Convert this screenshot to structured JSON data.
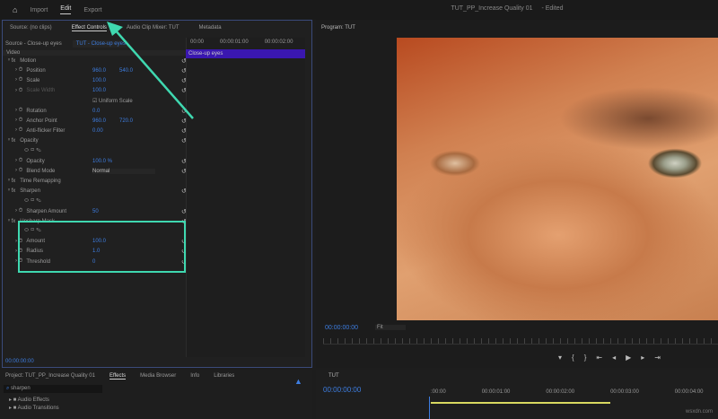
{
  "topbar": {
    "tabs": [
      "Import",
      "Edit",
      "Export"
    ],
    "active": "Edit",
    "title": "TUT_PP_Increase Quality 01",
    "status": "- Edited"
  },
  "left_panel": {
    "tabs": [
      "Source: (no clips)",
      "Effect Controls",
      "Audio Clip Mixer: TUT",
      "Metadata"
    ],
    "source_label": "Source - Close-up eyes",
    "sequence_label": "TUT - Close-up eyes",
    "timeline_ticks": [
      "00:00",
      "00:00:01:00",
      "00:00:02:00"
    ],
    "clip_name": "Close-up eyes",
    "section": "Video",
    "rows": [
      {
        "label": "Motion",
        "type": "fx"
      },
      {
        "label": "Position",
        "v1": "960.0",
        "v2": "540.0"
      },
      {
        "label": "Scale",
        "v1": "100.0"
      },
      {
        "label": "Scale Width",
        "v1": "100.0",
        "disabled": true
      },
      {
        "label": "Uniform Scale",
        "type": "check"
      },
      {
        "label": "Rotation",
        "v1": "0.0"
      },
      {
        "label": "Anchor Point",
        "v1": "960.0",
        "v2": "720.0"
      },
      {
        "label": "Anti-flicker Filter",
        "v1": "0.00"
      },
      {
        "label": "Opacity",
        "type": "fx"
      },
      {
        "label": "",
        "type": "masks"
      },
      {
        "label": "Opacity",
        "v1": "100.0 %"
      },
      {
        "label": "Blend Mode",
        "v1": "Normal",
        "type": "select"
      },
      {
        "label": "Time Remapping",
        "type": "fx"
      },
      {
        "label": "Sharpen",
        "type": "fx"
      },
      {
        "label": "",
        "type": "masks"
      },
      {
        "label": "Sharpen Amount",
        "v1": "50"
      },
      {
        "label": "Unsharp Mask",
        "type": "fx"
      },
      {
        "label": "",
        "type": "masks"
      },
      {
        "label": "Amount",
        "v1": "100.0"
      },
      {
        "label": "Radius",
        "v1": "1.0"
      },
      {
        "label": "Threshold",
        "v1": "0"
      }
    ],
    "timecode": "00:00:00:00"
  },
  "program": {
    "title": "Program: TUT",
    "timecode": "00:00:00:00",
    "zoom": "Fit"
  },
  "project": {
    "tabs": [
      "Project: TUT_PP_Increase Quality 01",
      "Effects",
      "Media Browser",
      "Info",
      "Libraries"
    ],
    "search": "sharpen",
    "items": [
      "Audio Effects",
      "Audio Transitions"
    ]
  },
  "timeline": {
    "title": "TUT",
    "timecode": "00:00:00:00",
    "ticks": [
      ":00:00",
      "00:00:01:00",
      "00:00:02:00",
      "00:00:03:00",
      "00:00:04:00"
    ]
  },
  "watermark": "wsxdn.com",
  "colors": {
    "accent": "#3d7de0",
    "annotation": "#3fd8b0",
    "clip": "#3a17b0"
  }
}
